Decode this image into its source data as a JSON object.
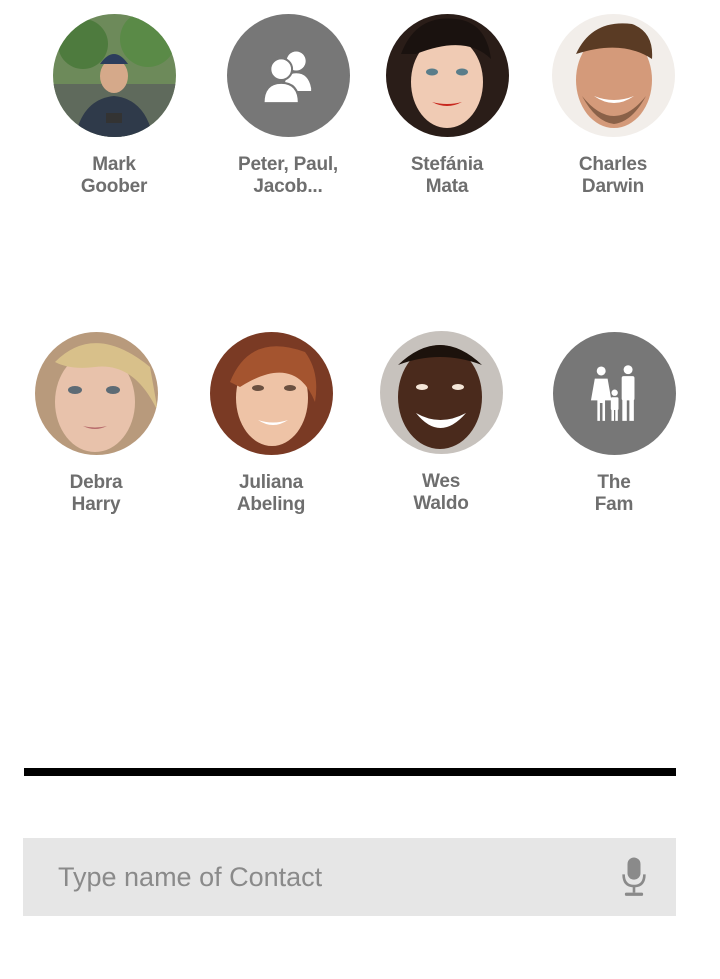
{
  "contacts": [
    {
      "name_line1": "Mark",
      "name_line2": "Goober",
      "type": "person"
    },
    {
      "name_line1": "Peter, Paul,",
      "name_line2": "Jacob...",
      "type": "group",
      "icon": "group-icon"
    },
    {
      "name_line1": "Stefánia",
      "name_line2": "Mata",
      "type": "person"
    },
    {
      "name_line1": "Charles",
      "name_line2": "Darwin",
      "type": "person"
    },
    {
      "name_line1": "Debra",
      "name_line2": "Harry",
      "type": "person"
    },
    {
      "name_line1": "Juliana",
      "name_line2": "Abeling",
      "type": "person"
    },
    {
      "name_line1": "Wes",
      "name_line2": "Waldo",
      "type": "person"
    },
    {
      "name_line1": "The",
      "name_line2": "Fam",
      "type": "group",
      "icon": "family-icon"
    }
  ],
  "search": {
    "placeholder": "Type name of Contact",
    "value": "",
    "mic_icon": "microphone-icon"
  },
  "colors": {
    "group_avatar": "#777777",
    "label_text": "#6e6e6e",
    "search_bg": "#e6e6e6",
    "divider": "#000000"
  }
}
